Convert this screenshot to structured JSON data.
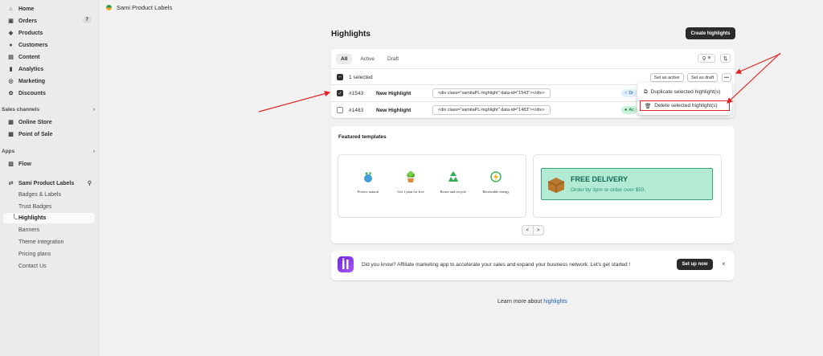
{
  "app_bar": {
    "app_name": "Sami Product Labels"
  },
  "sidebar": {
    "items": [
      {
        "label": "Home",
        "icon": "home-icon"
      },
      {
        "label": "Orders",
        "icon": "inbox-icon",
        "count": "7"
      },
      {
        "label": "Products",
        "icon": "tag-icon"
      },
      {
        "label": "Customers",
        "icon": "person-icon"
      },
      {
        "label": "Content",
        "icon": "content-icon"
      },
      {
        "label": "Analytics",
        "icon": "bar-chart-icon"
      },
      {
        "label": "Marketing",
        "icon": "target-icon"
      },
      {
        "label": "Discounts",
        "icon": "discount-icon"
      }
    ],
    "sales_channels": {
      "heading": "Sales channels",
      "items": [
        {
          "label": "Online Store",
          "icon": "store-icon"
        },
        {
          "label": "Point of Sale",
          "icon": "pos-icon"
        }
      ]
    },
    "apps": {
      "heading": "Apps",
      "items": [
        {
          "label": "Flow",
          "icon": "flow-icon"
        }
      ]
    },
    "sami": {
      "label": "Sami Product Labels",
      "subitems": [
        "Badges & Labels",
        "Trust Badges",
        "Highlights",
        "Banners",
        "Theme integration",
        "Pricing plans",
        "Contact Us"
      ],
      "active": "Highlights"
    }
  },
  "main": {
    "title": "Highlights",
    "create_button": "Create highlights",
    "tabs": [
      "All",
      "Active",
      "Draft"
    ],
    "selected_text": "1 selected",
    "bulk_actions": {
      "set_active": "Set as active",
      "set_draft": "Set as draft",
      "more": "•••"
    },
    "rows": [
      {
        "id": "#1543",
        "name": "New Highlight",
        "code": "<div class=\"samitaPL-highlight\" data-id=\"1543\"></div>",
        "status": "Dr",
        "checked": true
      },
      {
        "id": "#1483",
        "name": "New Highlight",
        "code": "<div class=\"samitaPL-highlight\" data-id=\"1483\"></div>",
        "status": "Ac",
        "checked": false
      }
    ],
    "menu": {
      "duplicate": "Duplicate selected highlight(s)",
      "delete": "Delete selected highlight(s)"
    }
  },
  "featured": {
    "title": "Featured templates",
    "items": [
      "Protect natural",
      "Get 1 plan for free",
      "Reuse and recycle",
      "Renewable energy"
    ],
    "promo": {
      "title": "FREE DELIVERY",
      "subtitle": "Order by 3pm or order over $50."
    },
    "pager": {
      "prev": "<",
      "next": ">"
    }
  },
  "banner": {
    "text": "Did you know? Affiliate marketing app to accelerate your sales and expand your business network. Let's get started !",
    "button": "Set up now",
    "close": "×"
  },
  "footer": {
    "prefix": "Learn more about",
    "link": "highlights"
  },
  "colors": {
    "accent": "#2b2b2b",
    "link": "#1a5fc2",
    "highlight_border": "#e02424",
    "arrow": "#e02424",
    "promo_bg": "#b3ead3"
  }
}
